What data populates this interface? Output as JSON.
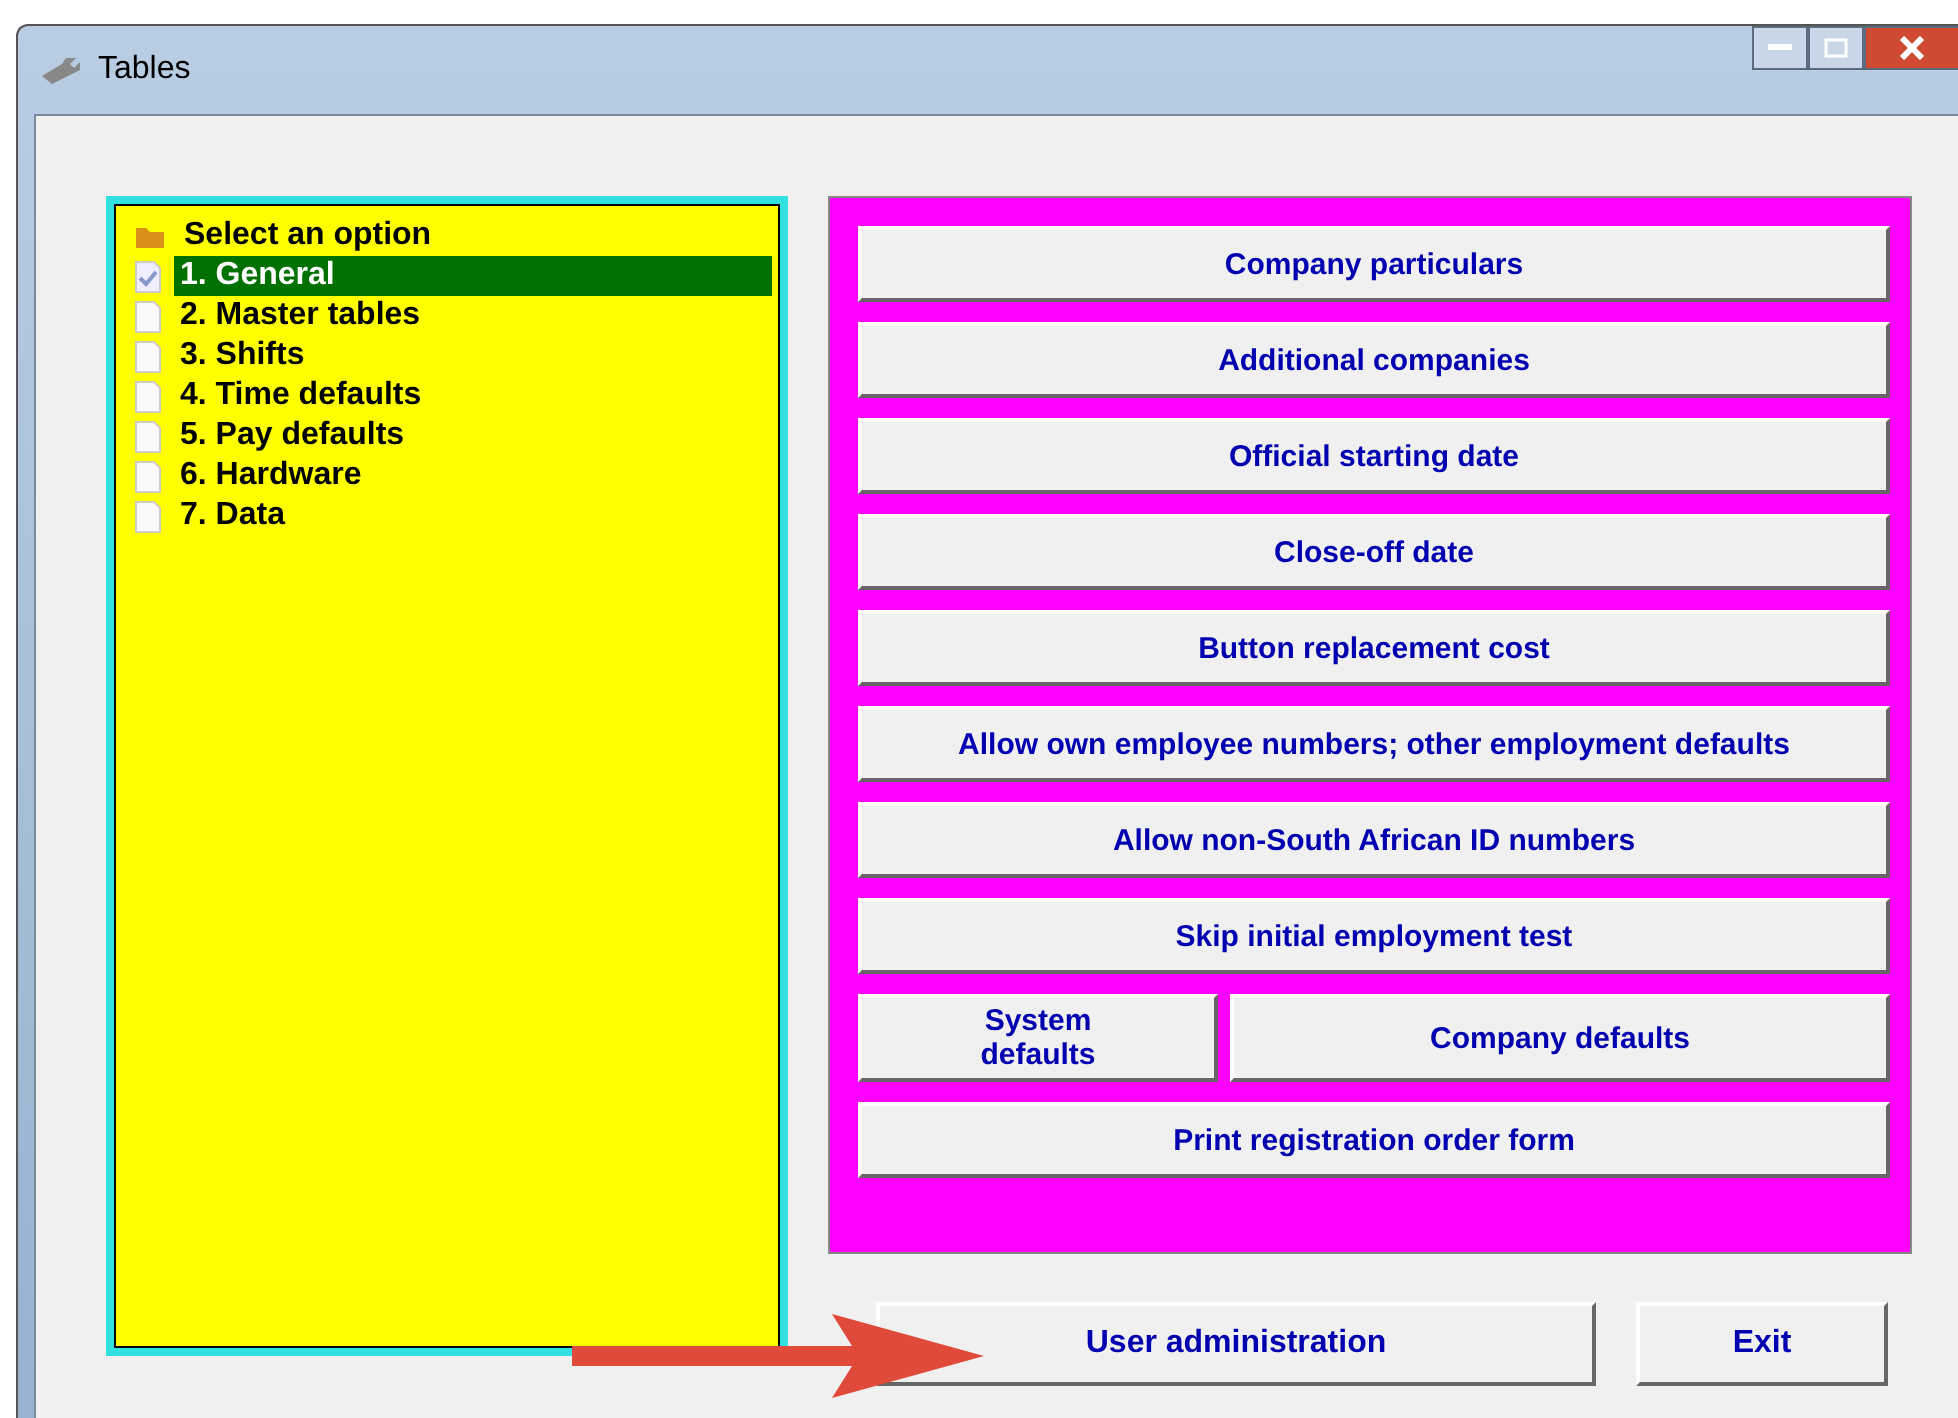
{
  "window": {
    "title": "Tables"
  },
  "tree": {
    "root": "Select an option",
    "items": [
      {
        "label": "1. General",
        "selected": true
      },
      {
        "label": "2. Master tables",
        "selected": false
      },
      {
        "label": "3. Shifts",
        "selected": false
      },
      {
        "label": "4. Time defaults",
        "selected": false
      },
      {
        "label": "5. Pay defaults",
        "selected": false
      },
      {
        "label": "6. Hardware",
        "selected": false
      },
      {
        "label": "7. Data",
        "selected": false
      }
    ]
  },
  "option_rows": [
    [
      "Company particulars"
    ],
    [
      "Additional companies"
    ],
    [
      "Official starting date"
    ],
    [
      "Close-off date"
    ],
    [
      "Button replacement cost"
    ],
    [
      "Allow own employee numbers; other employment defaults"
    ],
    [
      "Allow non-South African ID numbers"
    ],
    [
      "Skip initial employment test"
    ],
    [
      "System defaults",
      "Company defaults"
    ],
    [
      "Print registration order form"
    ]
  ],
  "bottom_buttons": [
    "User administration",
    "Exit"
  ]
}
